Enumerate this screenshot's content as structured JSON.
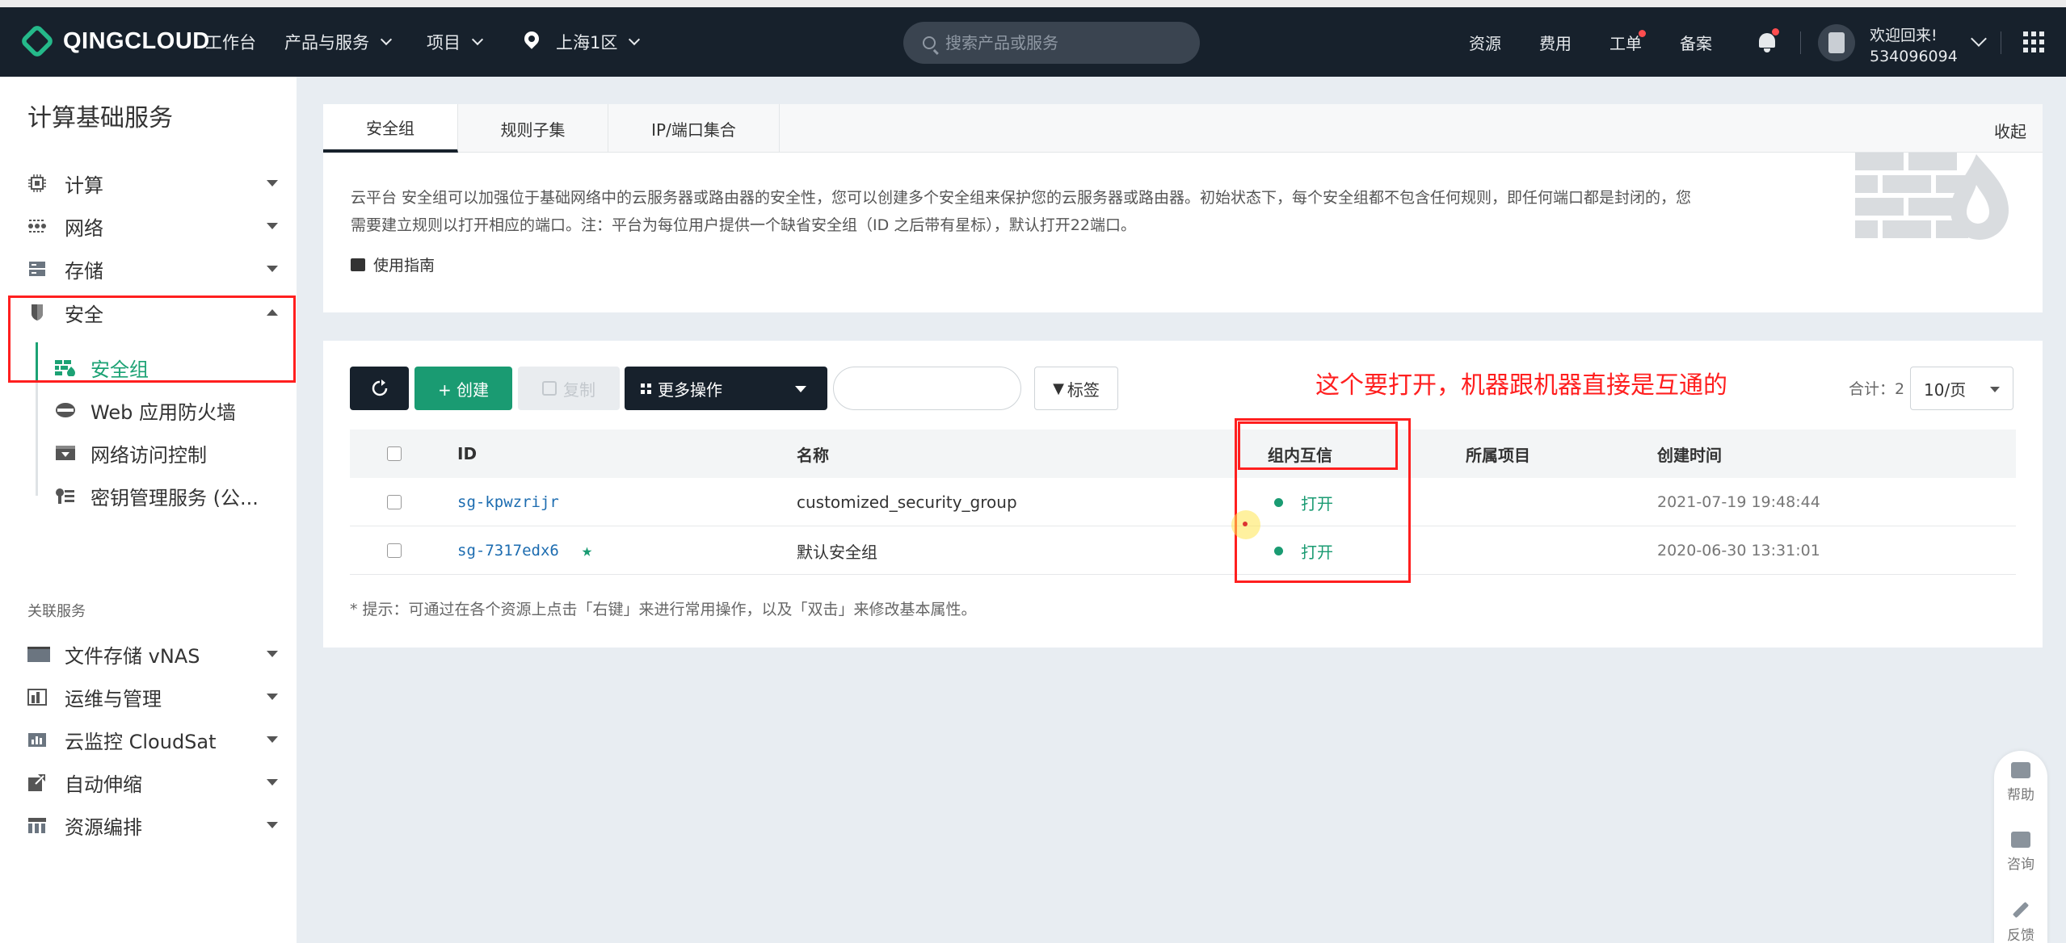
{
  "header": {
    "logo": "QINGCLOUD",
    "nav": [
      "工作台",
      "产品与服务",
      "项目"
    ],
    "region": "上海1区",
    "search_placeholder": "搜索产品或服务",
    "right_links": [
      "资源",
      "费用",
      "工单",
      "备案"
    ],
    "welcome": "欢迎回来!",
    "user_id": "534096094"
  },
  "sidebar": {
    "title": "计算基础服务",
    "items": [
      {
        "label": "计算",
        "icon": "chip-icon"
      },
      {
        "label": "网络",
        "icon": "network-icon"
      },
      {
        "label": "存储",
        "icon": "storage-icon"
      },
      {
        "label": "安全",
        "icon": "shield-icon"
      }
    ],
    "sub_items": [
      {
        "label": "安全组",
        "icon": "firewall-icon"
      },
      {
        "label": "Web 应用防火墙",
        "icon": "waf-icon"
      },
      {
        "label": "网络访问控制",
        "icon": "access-control-icon"
      },
      {
        "label": "密钥管理服务 (公...",
        "icon": "key-icon"
      }
    ],
    "related_title": "关联服务",
    "related": [
      {
        "label": "文件存储 vNAS",
        "icon": "folder-icon"
      },
      {
        "label": "运维与管理",
        "icon": "ops-icon"
      },
      {
        "label": "云监控 CloudSat",
        "icon": "monitor-icon"
      },
      {
        "label": "自动伸缩",
        "icon": "autoscale-icon"
      },
      {
        "label": "资源编排",
        "icon": "orchestration-icon"
      }
    ]
  },
  "tabs": [
    "安全组",
    "规则子集",
    "IP/端口集合"
  ],
  "collapse_label": "收起",
  "intro": {
    "line1": "云平台 安全组可以加强位于基础网络中的云服务器或路由器的安全性，您可以创建多个安全组来保护您的云服务器或路由器。初始状态下，每个安全组都不包含任何规则，即任何端口都是封闭的，您",
    "line2": "需要建立规则以打开相应的端口。注：平台为每位用户提供一个缺省安全组（ID 之后带有星标），默认打开22端口。",
    "guide": "使用指南"
  },
  "toolbar": {
    "create": "+ 创建",
    "copy": "复制",
    "more": "更多操作",
    "tag": "标签",
    "total": "合计：2",
    "per_page": "10/页"
  },
  "annotation": "这个要打开，机器跟机器直接是互通的",
  "table": {
    "headers": [
      "ID",
      "名称",
      "组内互信",
      "所属项目",
      "创建时间"
    ],
    "rows": [
      {
        "id": "sg-kpwzrijr",
        "name": "customized_security_group",
        "trust": "打开",
        "project": "",
        "created": "2021-07-19 19:48:44",
        "default": false
      },
      {
        "id": "sg-7317edx6",
        "name": "默认安全组",
        "trust": "打开",
        "project": "",
        "created": "2020-06-30 13:31:01",
        "default": true
      }
    ]
  },
  "tip": "* 提示：可通过在各个资源上点击「右键」来进行常用操作，以及「双击」来修改基本属性。",
  "float_help": [
    "帮助",
    "咨询",
    "反馈"
  ],
  "colors": {
    "accent": "#1a9b72",
    "topbar": "#17212c",
    "annotation": "#ff1f1f"
  }
}
